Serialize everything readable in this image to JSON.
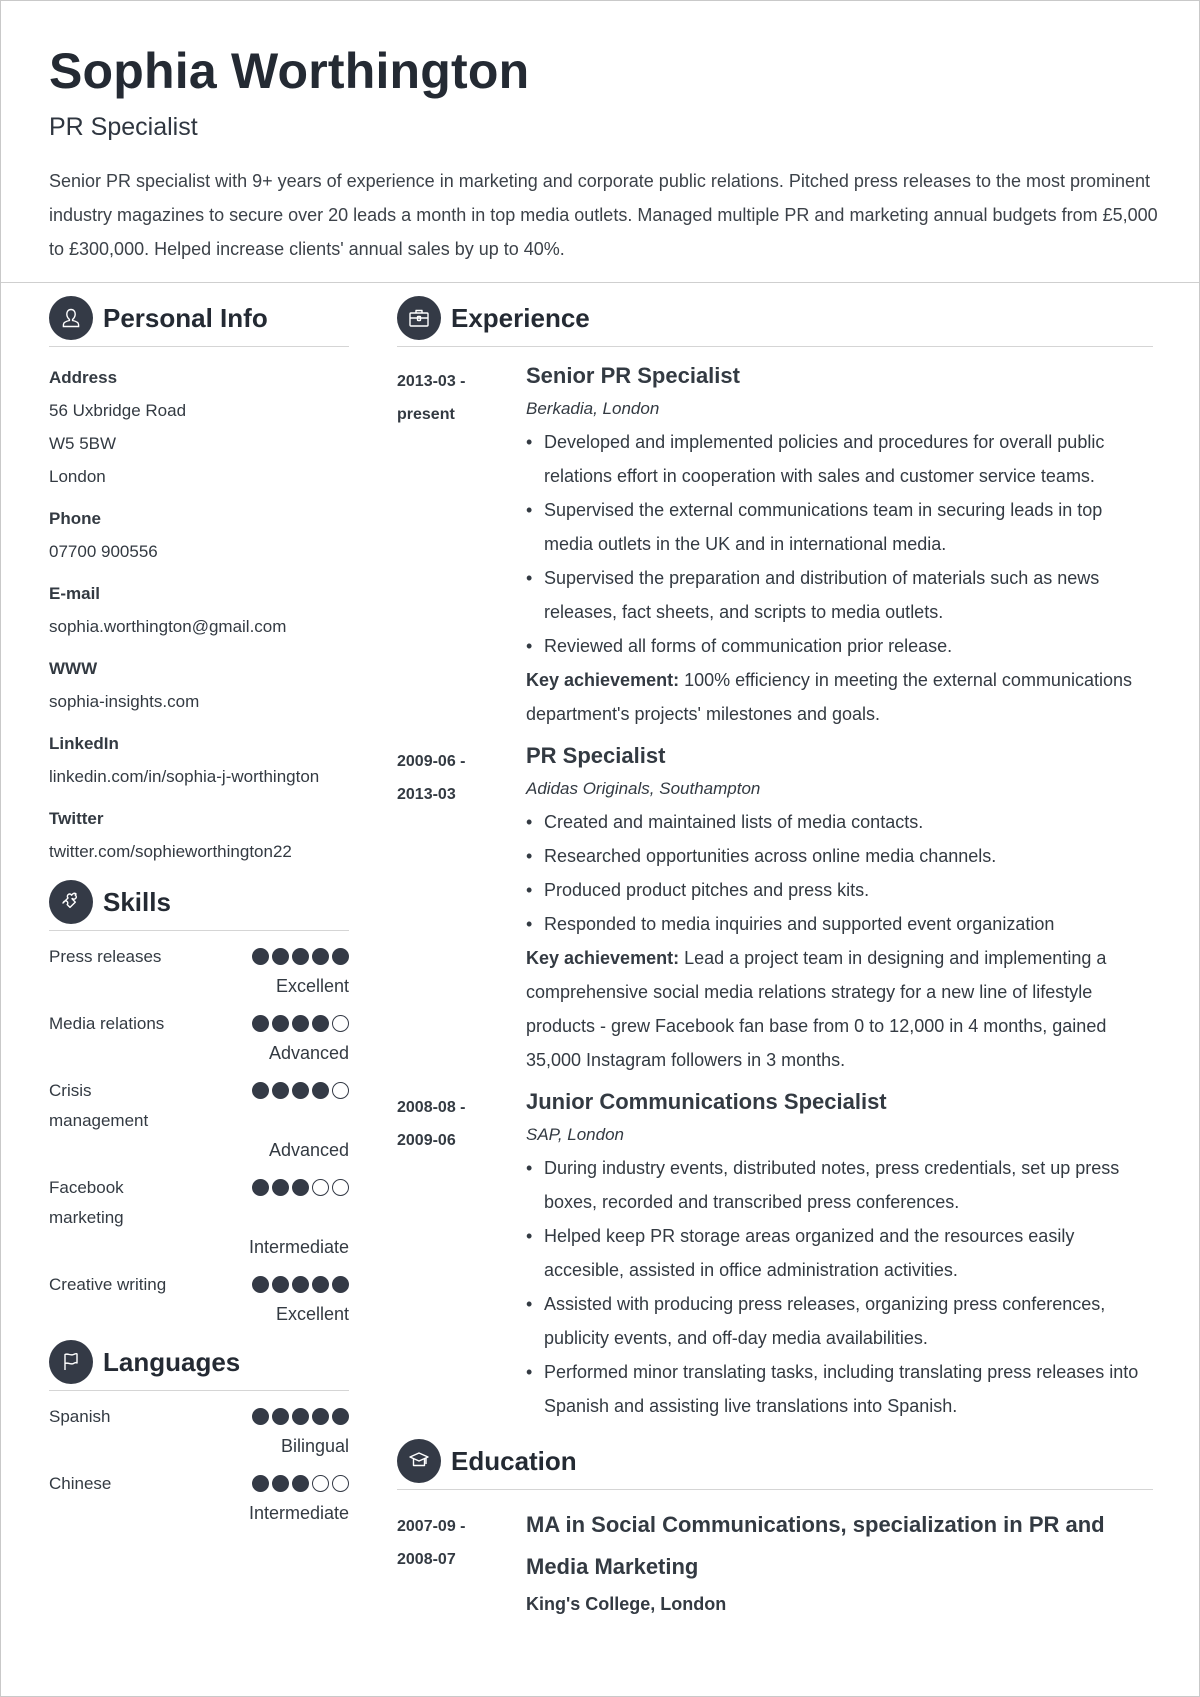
{
  "header": {
    "name": "Sophia Worthington",
    "title": "PR Specialist",
    "summary": "Senior PR specialist with 9+ years of experience in marketing and corporate public relations. Pitched press releases to the most prominent industry magazines to secure over 20 leads a month in top media outlets. Managed multiple PR and marketing annual budgets from £5,000 to £300,000. Helped increase clients' annual sales by up to 40%."
  },
  "colors": {
    "accent": "#343a46",
    "text": "#333a42",
    "rule": "#d5d5d5"
  },
  "personal_info": {
    "heading": "Personal Info",
    "icon": "person-icon",
    "address": {
      "label": "Address",
      "lines": [
        "56 Uxbridge Road",
        "W5 5BW",
        "London"
      ]
    },
    "phone": {
      "label": "Phone",
      "value": "07700 900556"
    },
    "email": {
      "label": "E-mail",
      "value": "sophia.worthington@gmail.com"
    },
    "www": {
      "label": "WWW",
      "value": "sophia-insights.com"
    },
    "linkedin": {
      "label": "LinkedIn",
      "value": "linkedin.com/in/sophia-j-worthington"
    },
    "twitter": {
      "label": "Twitter",
      "value": "twitter.com/sophieworthington22"
    }
  },
  "skills": {
    "heading": "Skills",
    "icon": "puzzle-icon",
    "items": [
      {
        "name": "Press releases",
        "rating": 5,
        "max": 5,
        "level": "Excellent"
      },
      {
        "name": "Media relations",
        "rating": 4,
        "max": 5,
        "level": "Advanced"
      },
      {
        "name": "Crisis",
        "name_line2": "management",
        "rating": 4,
        "max": 5,
        "level": "Advanced"
      },
      {
        "name": "Facebook",
        "name_line2": "marketing",
        "rating": 3,
        "max": 5,
        "level": "Intermediate"
      },
      {
        "name": "Creative writing",
        "rating": 5,
        "max": 5,
        "level": "Excellent"
      }
    ]
  },
  "languages": {
    "heading": "Languages",
    "icon": "flag-icon",
    "items": [
      {
        "name": "Spanish",
        "rating": 5,
        "max": 5,
        "level": "Bilingual"
      },
      {
        "name": "Chinese",
        "rating": 3,
        "max": 5,
        "level": "Intermediate"
      }
    ]
  },
  "experience": {
    "heading": "Experience",
    "icon": "briefcase-icon",
    "jobs": [
      {
        "date_start": "2013-03 -",
        "date_end": "present",
        "title": "Senior PR Specialist",
        "company": "Berkadia, London",
        "bullets": [
          "Developed and implemented policies and procedures for overall public relations effort in cooperation with sales and customer service teams.",
          "Supervised the external communications team in securing leads in top media outlets in the UK and in international media.",
          "Supervised the preparation and distribution of materials such as news releases, fact sheets, and scripts to media outlets.",
          "Reviewed all forms of communication prior release."
        ],
        "key_label": "Key achievement:",
        "key_text": " 100% efficiency in meeting the external communications department's projects' milestones and goals."
      },
      {
        "date_start": "2009-06 -",
        "date_end": "2013-03",
        "title": "PR Specialist",
        "company": "Adidas Originals, Southampton",
        "bullets": [
          "Created and maintained lists of media contacts.",
          "Researched opportunities across online media channels.",
          "Produced product pitches and press kits.",
          "Responded to media inquiries and supported event organization"
        ],
        "key_label": "Key achievement:",
        "key_text": " Lead a project team in designing and implementing a comprehensive social media relations strategy for a new line of lifestyle products - grew Facebook fan base from 0 to 12,000 in 4 months, gained 35,000 Instagram followers in 3 months."
      },
      {
        "date_start": "2008-08 -",
        "date_end": "2009-06",
        "title": "Junior Communications Specialist",
        "company": "SAP, London",
        "bullets": [
          "During industry events, distributed notes, press credentials, set up press boxes, recorded and transcribed press conferences.",
          "Helped keep PR storage areas organized and the resources easily accesible, assisted in office administration activities.",
          "Assisted with producing press releases, organizing press conferences, publicity events, and off-day media availabilities.",
          "Performed minor translating tasks, including translating press releases into Spanish and assisting live translations into Spanish."
        ]
      }
    ]
  },
  "education": {
    "heading": "Education",
    "icon": "graduation-cap-icon",
    "items": [
      {
        "date_start": "2007-09 -",
        "date_end": "2008-07",
        "degree": "MA in Social Communications, specialization in PR and Media Marketing",
        "school": "King's College, London"
      }
    ]
  }
}
